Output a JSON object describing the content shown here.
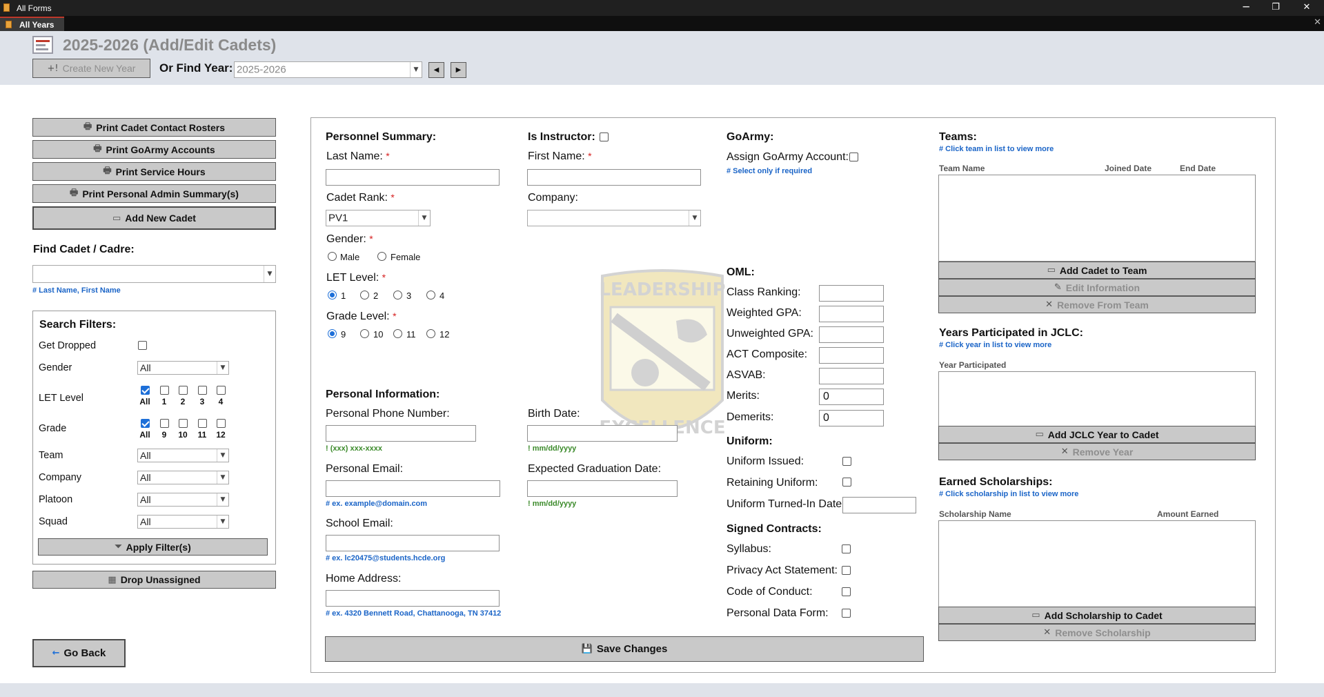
{
  "window": {
    "title": "All Forms",
    "min": "─",
    "restore": "❐",
    "close": "✕"
  },
  "tab": {
    "label": "All Years",
    "close": "✕"
  },
  "header": {
    "title": "2025-2026 (Add/Edit Cadets)",
    "create_year": "Create New Year",
    "find_year_label": "Or Find Year:",
    "find_year_value": "2025-2026",
    "prev": "◀",
    "next": "▶"
  },
  "left": {
    "btn_contact": "Print Cadet Contact Rosters",
    "btn_goarmy": "Print GoArmy Accounts",
    "btn_service": "Print Service Hours",
    "btn_admin": "Print Personal Admin Summary(s)",
    "btn_add_cadet": "Add New Cadet",
    "find_label": "Find Cadet / Cadre:",
    "find_value": "",
    "find_hint": "# Last Name, First Name",
    "btn_drop": "Drop Unassigned",
    "btn_back": "Go Back"
  },
  "filters": {
    "title": "Search Filters:",
    "get_dropped": "Get Dropped",
    "gender": "Gender",
    "gender_value": "All",
    "let_level": "LET Level",
    "let_options": [
      "All",
      "1",
      "2",
      "3",
      "4"
    ],
    "grade": "Grade",
    "grade_options": [
      "All",
      "9",
      "10",
      "11",
      "12"
    ],
    "team": "Team",
    "team_value": "All",
    "company": "Company",
    "company_value": "All",
    "platoon": "Platoon",
    "platoon_value": "All",
    "squad": "Squad",
    "squad_value": "All",
    "apply": "Apply Filter(s)"
  },
  "personnel": {
    "title": "Personnel Summary:",
    "is_instructor": "Is Instructor:",
    "last_name": "Last Name:",
    "first_name": "First Name:",
    "cadet_rank": "Cadet Rank:",
    "cadet_rank_value": "PV1",
    "company": "Company:",
    "gender": "Gender:",
    "male": "Male",
    "female": "Female",
    "let_level": "LET Level:",
    "let_options": [
      "1",
      "2",
      "3",
      "4"
    ],
    "grade_level": "Grade Level:",
    "grade_options": [
      "9",
      "10",
      "11",
      "12"
    ],
    "req": "*"
  },
  "goarmy": {
    "title": "GoArmy:",
    "assign": "Assign GoArmy Account:",
    "hint": "# Select only if required"
  },
  "personal": {
    "title": "Personal Information:",
    "phone": "Personal Phone Number:",
    "phone_hint": "! (xxx) xxx-xxxx",
    "birth": "Birth Date:",
    "birth_hint": "! mm/dd/yyyy",
    "email": "Personal Email:",
    "email_hint": "# ex. example@domain.com",
    "grad": "Expected Graduation Date:",
    "grad_hint": "! mm/dd/yyyy",
    "school_email": "School Email:",
    "school_hint": "# ex. lc20475@students.hcde.org",
    "address": "Home Address:",
    "address_hint": "# ex. 4320 Bennett Road, Chattanooga, TN 37412"
  },
  "oml": {
    "title": "OML:",
    "class_rank": "Class Ranking:",
    "wgpa": "Weighted GPA:",
    "ugpa": "Unweighted GPA:",
    "act": "ACT Composite:",
    "asvab": "ASVAB:",
    "merits": "Merits:",
    "merits_value": "0",
    "demerits": "Demerits:",
    "demerits_value": "0"
  },
  "uniform": {
    "title": "Uniform:",
    "issued": "Uniform Issued:",
    "retaining": "Retaining Uniform:",
    "turned_in": "Uniform Turned-In Date:"
  },
  "contracts": {
    "title": "Signed Contracts:",
    "syllabus": "Syllabus:",
    "privacy": "Privacy Act Statement:",
    "conduct": "Code of Conduct:",
    "pdf": "Personal Data Form:"
  },
  "save": "Save Changes",
  "teams": {
    "title": "Teams:",
    "hint": "# Click team in list to view more",
    "col_name": "Team Name",
    "col_joined": "Joined Date",
    "col_end": "End Date",
    "add": "Add Cadet to Team",
    "edit": "Edit Information",
    "remove": "Remove From Team"
  },
  "years": {
    "title": "Years Participated in JCLC:",
    "hint": "# Click year in list to view more",
    "col": "Year Participated",
    "add": "Add JCLC Year to Cadet",
    "remove": "Remove Year"
  },
  "scholarships": {
    "title": "Earned Scholarships:",
    "hint": "# Click scholarship in list to view more",
    "col_name": "Scholarship Name",
    "col_amount": "Amount Earned",
    "add": "Add Scholarship to Cadet",
    "remove": "Remove Scholarship"
  },
  "emblem": {
    "top": "LEADERSHIP",
    "bottom": "EXCELLENCE"
  },
  "colors": {
    "accent": "#1d6fd8",
    "hint_blue": "#1a64c7",
    "hint_green": "#3b8a2a",
    "required": "#d62020",
    "button": "#c9c9c9"
  }
}
